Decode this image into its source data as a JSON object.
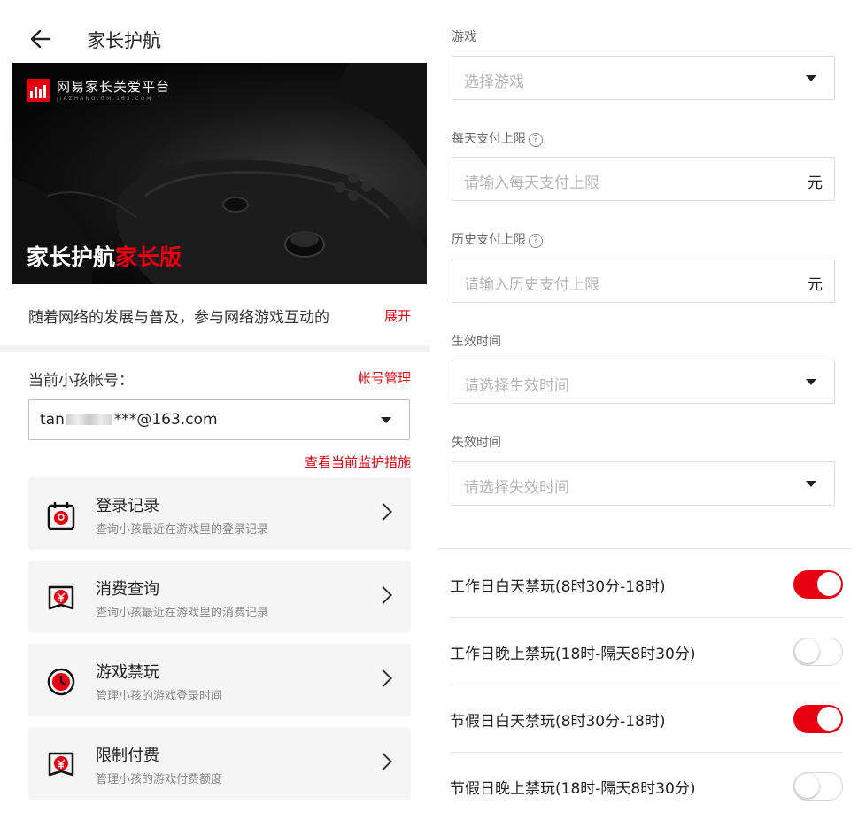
{
  "header": {
    "title": "家长护航"
  },
  "banner": {
    "brand_name": "网易家长关爱平台",
    "brand_sub": "JIAZHANG.GM.163.COM",
    "title_white": "家长护航",
    "title_red": "家长版"
  },
  "intro": {
    "text": "随着网络的发展与普及，参与网络游戏互动的",
    "expand_label": "展开"
  },
  "account": {
    "label": "当前小孩帐号：",
    "manage_label": "帐号管理",
    "value_prefix": "tan",
    "value_suffix": "***@163.com",
    "monitor_link": "查看当前监护措施"
  },
  "menu": [
    {
      "title": "登录记录",
      "subtitle": "查询小孩最近在游戏里的登录记录",
      "icon": "login-record-icon"
    },
    {
      "title": "消费查询",
      "subtitle": "查询小孩最近在游戏里的消费记录",
      "icon": "consumption-icon"
    },
    {
      "title": "游戏禁玩",
      "subtitle": "管理小孩的游戏登录时间",
      "icon": "clock-icon"
    },
    {
      "title": "限制付费",
      "subtitle": "管理小孩的游戏付费额度",
      "icon": "payment-limit-icon"
    }
  ],
  "form": {
    "game": {
      "label": "游戏",
      "placeholder": "选择游戏"
    },
    "daily_limit": {
      "label": "每天支付上限",
      "placeholder": "请输入每天支付上限",
      "unit": "元"
    },
    "history_limit": {
      "label": "历史支付上限",
      "placeholder": "请输入历史支付上限",
      "unit": "元"
    },
    "start_time": {
      "label": "生效时间",
      "placeholder": "请选择生效时间"
    },
    "end_time": {
      "label": "失效时间",
      "placeholder": "请选择失效时间"
    },
    "help_glyph": "?"
  },
  "toggles": [
    {
      "label": "工作日白天禁玩(8时30分-18时)",
      "on": true
    },
    {
      "label": "工作日晚上禁玩(18时-隔天8时30分)",
      "on": false
    },
    {
      "label": "节假日白天禁玩(8时30分-18时)",
      "on": true
    },
    {
      "label": "节假日晚上禁玩(18时-隔天8时30分)",
      "on": false
    }
  ],
  "colors": {
    "accent": "#e60012",
    "card_bg": "#f5f5f5",
    "placeholder": "#b5b5b5"
  }
}
